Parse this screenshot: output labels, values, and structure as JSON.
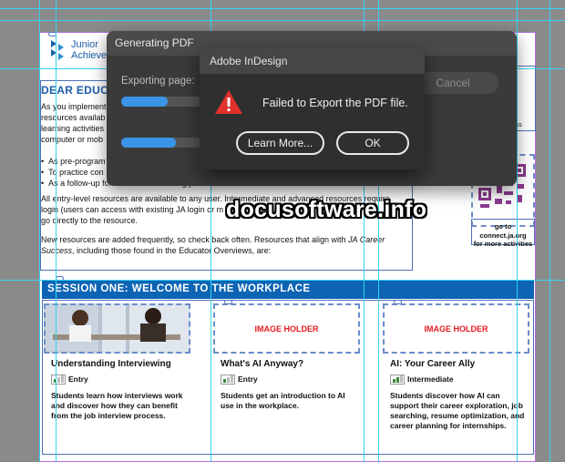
{
  "document": {
    "logo_line1": "Junior",
    "logo_line2": "Achieve",
    "heading": "DEAR EDUC",
    "para1": [
      "As you implement",
      "resources availab",
      "learning activities",
      "computer or mob"
    ],
    "bullets": [
      "As pre-program",
      "To practice con",
      "As a follow-up for unattended learning practice."
    ],
    "para2": [
      "All entry-level resources are available to any user. Intermediate and advanced resources require",
      "login (users can access with existing JA login or m",
      "go directly to the resource."
    ],
    "para3": [
      "New resources are added frequently, so check back often. Resources that align with",
      "JA Career",
      "Success",
      ", including those found in the Educator Overviews, are:"
    ],
    "qr_caption": [
      "go to connect.ja.org",
      "for more activities"
    ],
    "side_fragment": "ness",
    "session_title": "SESSION ONE: WELCOME TO THE WORKPLACE",
    "cards": [
      {
        "title": "Understanding Interviewing",
        "level": "Entry",
        "desc": "Students learn how interviews work and discover how they can benefit from the job interview process."
      },
      {
        "title": "What's AI Anyway?",
        "level": "Entry",
        "image_placeholder": "IMAGE HOLDER",
        "desc": "Students get an introduction to AI use in the workplace."
      },
      {
        "title": "AI: Your Career Ally",
        "level": "Intermediate",
        "image_placeholder": "IMAGE HOLDER",
        "desc": "Students discover how AI can support their career exploration, job searching, resume optimization, and career planning for internships."
      }
    ]
  },
  "progress_dialog": {
    "title": "Generating PDF",
    "status_label": "Exporting page:",
    "cancel_label": "Cancel",
    "progress_page": 0.17,
    "progress_total": 0.2
  },
  "alert": {
    "title": "Adobe InDesign",
    "message": "Failed to Export the PDF file.",
    "learn_more_label": "Learn More...",
    "ok_label": "OK"
  },
  "watermark": "docusoftware.info",
  "colors": {
    "accent": "#0d64b4",
    "alert_icon": "#e0312b",
    "progress": "#3a94e8",
    "placeholder_text": "#e31b23"
  }
}
